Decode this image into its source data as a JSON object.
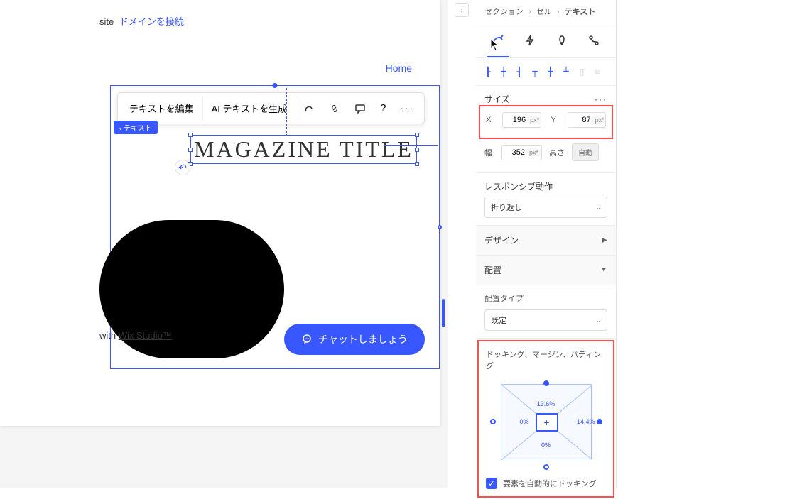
{
  "topbar": {
    "site_label": "site",
    "connect_domain": "ドメインを接続"
  },
  "nav": {
    "home": "Home"
  },
  "floating_toolbar": {
    "edit_text": "テキストを編集",
    "ai_text": "AI テキストを生成"
  },
  "element_tag": "テキスト",
  "magazine_title": "MAGAZINE TITLE",
  "footer": {
    "prefix": "with ",
    "brand": "Wix Studio™"
  },
  "chat_button": "チャットしましょう",
  "panel": {
    "breadcrumb": {
      "section": "セクション",
      "cell": "セル",
      "text": "テキスト"
    },
    "size": {
      "label": "サイズ",
      "x_label": "X",
      "x_value": "196",
      "x_unit": "px*",
      "y_label": "Y",
      "y_value": "87",
      "y_unit": "px*",
      "w_label": "幅",
      "w_value": "352",
      "w_unit": "px*",
      "h_label": "高さ",
      "h_auto": "自動"
    },
    "responsive": {
      "label": "レスポンシブ動作",
      "value": "折り返し"
    },
    "design": "デザイン",
    "position": "配置",
    "position_type": {
      "label": "配置タイプ",
      "value": "既定"
    },
    "docking": {
      "label": "ドッキング、マージン、パディング",
      "top": "13.6%",
      "right": "14.4%",
      "left": "0%",
      "bottom": "0%",
      "auto_dock": "要素を自動的にドッキング"
    }
  }
}
